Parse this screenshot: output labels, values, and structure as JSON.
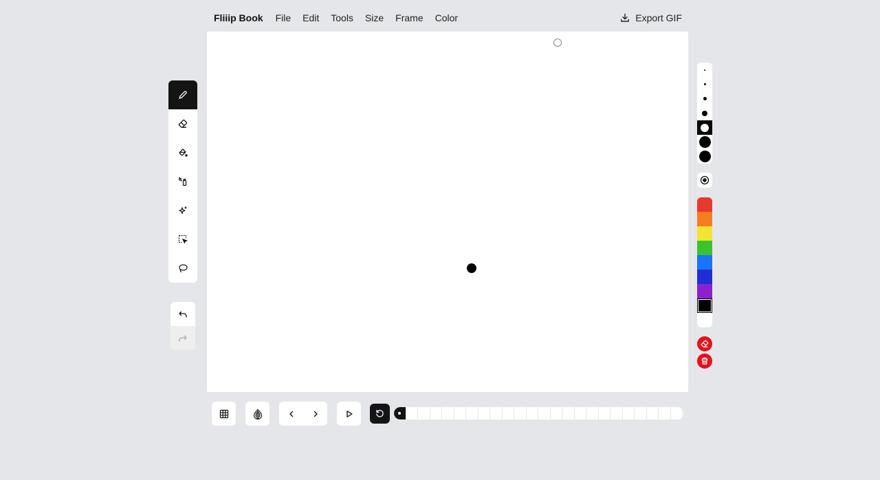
{
  "app": {
    "title": "Fliiip Book"
  },
  "menu": [
    {
      "label": "File"
    },
    {
      "label": "Edit"
    },
    {
      "label": "Tools"
    },
    {
      "label": "Size"
    },
    {
      "label": "Frame"
    },
    {
      "label": "Color"
    }
  ],
  "export": {
    "label": "Export GIF",
    "icon": "download-icon"
  },
  "tools": [
    {
      "name": "pen",
      "icon": "pen-icon",
      "active": true
    },
    {
      "name": "eraser",
      "icon": "eraser-icon",
      "active": false
    },
    {
      "name": "fill",
      "icon": "paint-bucket-icon",
      "active": false
    },
    {
      "name": "spray",
      "icon": "spray-can-icon",
      "active": false
    },
    {
      "name": "sparkle",
      "icon": "sparkle-icon",
      "active": false
    },
    {
      "name": "select",
      "icon": "select-icon",
      "active": false
    },
    {
      "name": "lasso",
      "icon": "lasso-icon",
      "active": false
    }
  ],
  "history": {
    "undo_icon": "undo-icon",
    "redo_icon": "redo-icon",
    "redo_enabled": false
  },
  "brush_sizes": {
    "count": 7,
    "selected_index": 4
  },
  "palette": {
    "colors": [
      "#e8392e",
      "#f77c1f",
      "#f5e432",
      "#39c32c",
      "#1a74f5",
      "#1f2fd6",
      "#8b21cf",
      "#000000",
      "#ffffff"
    ],
    "selected": "#000000"
  },
  "actions": {
    "clear_icon": "clear-eraser-icon",
    "delete_icon": "trash-icon",
    "danger_color": "#e8111b"
  },
  "playback": {
    "grid_icon": "grid-icon",
    "onion_icon": "onion-skin-icon",
    "prev_icon": "chevron-left-icon",
    "next_icon": "chevron-right-icon",
    "play_icon": "play-icon",
    "loop_icon": "loop-icon",
    "loop_enabled": true
  },
  "timeline": {
    "frame_count": 24,
    "current_frame": 1
  }
}
